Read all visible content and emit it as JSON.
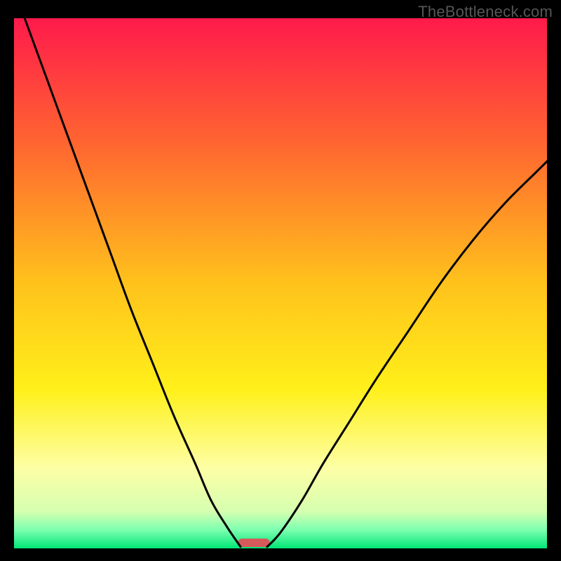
{
  "watermark": "TheBottleneck.com",
  "chart_data": {
    "type": "line",
    "title": "",
    "xlabel": "",
    "ylabel": "",
    "xlim": [
      0,
      100
    ],
    "ylim": [
      0,
      100
    ],
    "grid": false,
    "legend": false,
    "background_gradient": {
      "stops": [
        {
          "offset": 0.0,
          "color": "#ff1a4b"
        },
        {
          "offset": 0.25,
          "color": "#ff6a2f"
        },
        {
          "offset": 0.5,
          "color": "#ffc21c"
        },
        {
          "offset": 0.7,
          "color": "#fff01a"
        },
        {
          "offset": 0.85,
          "color": "#fdffa6"
        },
        {
          "offset": 0.93,
          "color": "#d6ffb0"
        },
        {
          "offset": 0.965,
          "color": "#7dffb0"
        },
        {
          "offset": 1.0,
          "color": "#00e676"
        }
      ]
    },
    "series": [
      {
        "name": "left-curve",
        "x": [
          2,
          6,
          10,
          14,
          18,
          22,
          26,
          30,
          34,
          37,
          40,
          42.5
        ],
        "y": [
          100,
          89,
          78,
          67,
          56,
          45,
          35,
          25,
          16,
          9,
          4,
          0.3
        ]
      },
      {
        "name": "right-curve",
        "x": [
          47.5,
          50,
          54,
          58,
          63,
          68,
          74,
          80,
          86,
          92,
          98,
          100
        ],
        "y": [
          0.3,
          3,
          9,
          16,
          24,
          32,
          41,
          50,
          58,
          65,
          71,
          73
        ]
      }
    ],
    "marker": {
      "name": "bottleneck-marker",
      "x_center": 45,
      "width": 6,
      "color": "#d65a5a"
    }
  }
}
